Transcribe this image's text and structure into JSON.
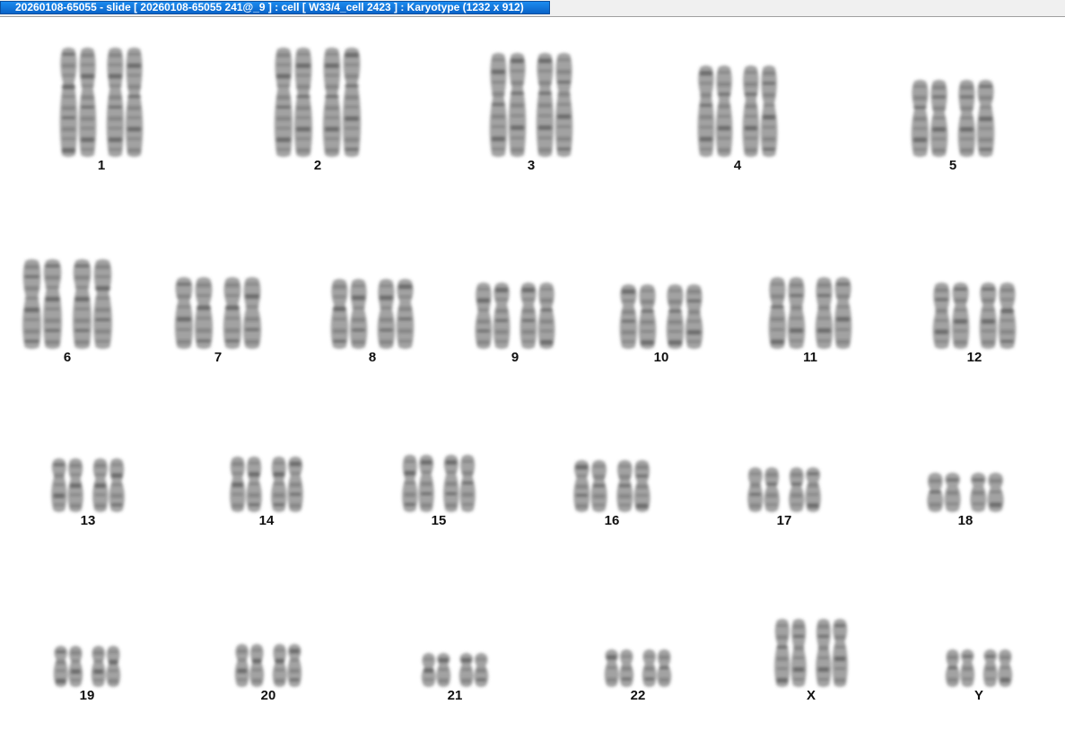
{
  "window": {
    "title": "20260108-65055 - slide [ 20260108-65055 241@_9 ] : cell [ W33/4_cell 2423 ] : Karyotype  (1232 x 912)"
  },
  "karyotype": {
    "chromosomes": [
      {
        "label": "1"
      },
      {
        "label": "2"
      },
      {
        "label": "3"
      },
      {
        "label": "4"
      },
      {
        "label": "5"
      },
      {
        "label": "6"
      },
      {
        "label": "7"
      },
      {
        "label": "8"
      },
      {
        "label": "9"
      },
      {
        "label": "10"
      },
      {
        "label": "11"
      },
      {
        "label": "12"
      },
      {
        "label": "13"
      },
      {
        "label": "14"
      },
      {
        "label": "15"
      },
      {
        "label": "16"
      },
      {
        "label": "17"
      },
      {
        "label": "18"
      },
      {
        "label": "19"
      },
      {
        "label": "20"
      },
      {
        "label": "21"
      },
      {
        "label": "22"
      },
      {
        "label": "X"
      },
      {
        "label": "Y"
      }
    ]
  },
  "colors": {
    "titlebar": "#0a63c7",
    "chromosome": "#555555",
    "label": "#111111"
  }
}
